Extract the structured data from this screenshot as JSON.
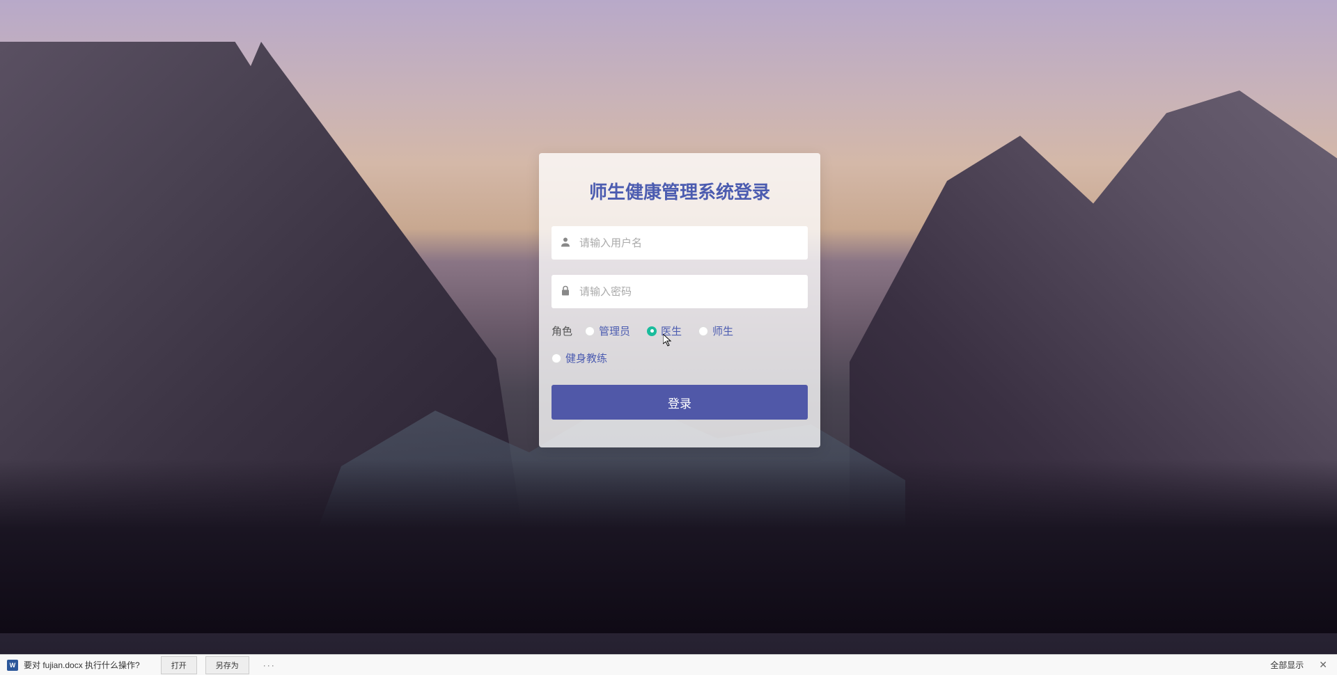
{
  "login": {
    "title": "师生健康管理系统登录",
    "username_placeholder": "请输入用户名",
    "password_placeholder": "请输入密码",
    "role_label": "角色",
    "roles": {
      "admin": "管理员",
      "doctor": "医生",
      "student_teacher": "师生",
      "fitness_coach": "健身教练"
    },
    "selected_role": "doctor",
    "login_button": "登录"
  },
  "download_bar": {
    "icon_text": "W",
    "message": "要对 fujian.docx 执行什么操作?",
    "open_button": "打开",
    "save_as_button": "另存为",
    "more": "···",
    "show_all": "全部显示",
    "close": "✕"
  }
}
